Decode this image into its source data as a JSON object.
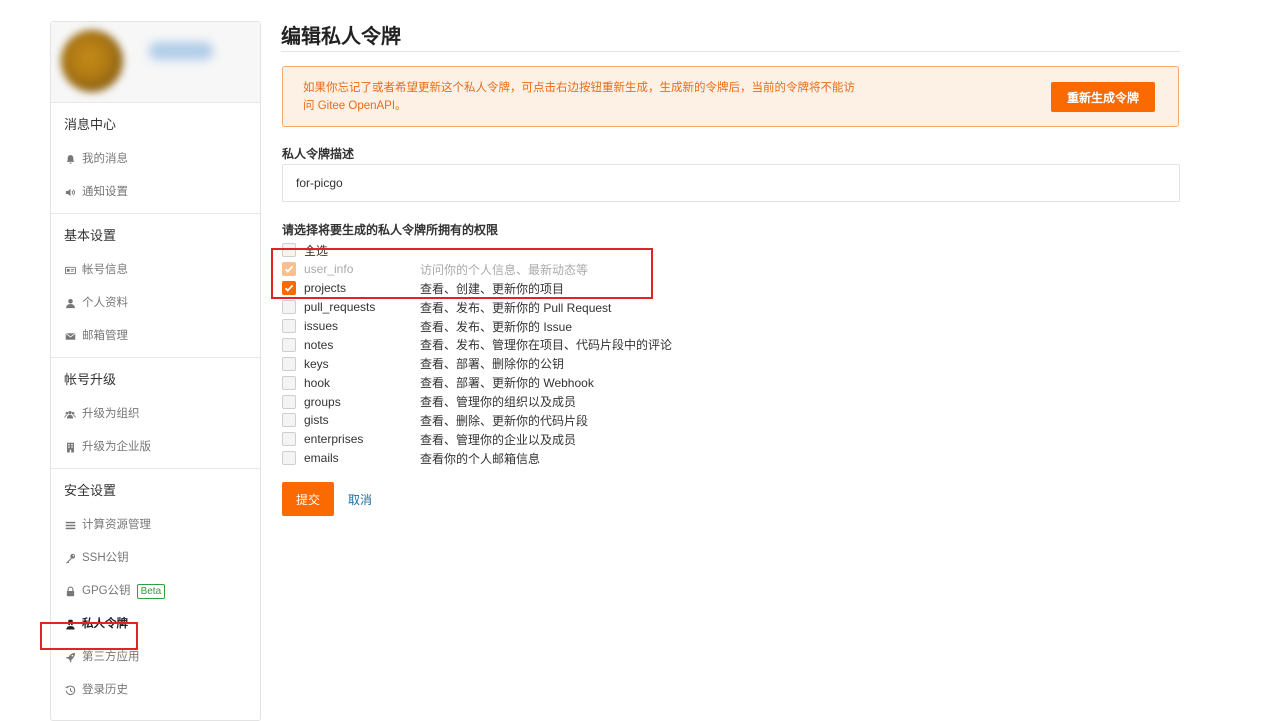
{
  "sidebar": {
    "sections": [
      {
        "title": "消息中心",
        "items": [
          {
            "label": "我的消息",
            "icon": "bell-icon"
          },
          {
            "label": "通知设置",
            "icon": "speaker-icon"
          }
        ]
      },
      {
        "title": "基本设置",
        "items": [
          {
            "label": "帐号信息",
            "icon": "id-card-icon"
          },
          {
            "label": "个人资料",
            "icon": "user-icon"
          },
          {
            "label": "邮箱管理",
            "icon": "envelope-icon"
          }
        ]
      },
      {
        "title": "帐号升级",
        "items": [
          {
            "label": "升级为组织",
            "icon": "users-icon"
          },
          {
            "label": "升级为企业版",
            "icon": "building-icon"
          }
        ]
      },
      {
        "title": "安全设置",
        "items": [
          {
            "label": "计算资源管理",
            "icon": "list-icon"
          },
          {
            "label": "SSH公钥",
            "icon": "key-icon"
          },
          {
            "label": "GPG公钥",
            "icon": "lock-icon",
            "badge": "Beta"
          },
          {
            "label": "私人令牌",
            "icon": "user-secret-icon",
            "active": true
          },
          {
            "label": "第三方应用",
            "icon": "rocket-icon"
          },
          {
            "label": "登录历史",
            "icon": "history-icon"
          }
        ]
      }
    ]
  },
  "main": {
    "title": "编辑私人令牌",
    "notice": {
      "line1": "如果你忘记了或者希望更新这个私人令牌，可点击右边按钮重新生成，生成新的令牌后，当前的令牌将不能访",
      "line2": "问 Gitee OpenAPI。",
      "button_label": "重新生成令牌"
    },
    "description_label": "私人令牌描述",
    "description_value": "for-picgo",
    "permissions_label": "请选择将要生成的私人令牌所拥有的权限",
    "select_all_label": "全选",
    "permissions": [
      {
        "name": "user_info",
        "desc": "访问你的个人信息、最新动态等",
        "checked": true,
        "disabled": true
      },
      {
        "name": "projects",
        "desc": "查看、创建、更新你的项目",
        "checked": true
      },
      {
        "name": "pull_requests",
        "desc": "查看、发布、更新你的 Pull Request",
        "checked": false
      },
      {
        "name": "issues",
        "desc": "查看、发布、更新你的 Issue",
        "checked": false
      },
      {
        "name": "notes",
        "desc": "查看、发布、管理你在项目、代码片段中的评论",
        "checked": false
      },
      {
        "name": "keys",
        "desc": "查看、部署、删除你的公钥",
        "checked": false
      },
      {
        "name": "hook",
        "desc": "查看、部署、更新你的 Webhook",
        "checked": false
      },
      {
        "name": "groups",
        "desc": "查看、管理你的组织以及成员",
        "checked": false
      },
      {
        "name": "gists",
        "desc": "查看、删除、更新你的代码片段",
        "checked": false
      },
      {
        "name": "enterprises",
        "desc": "查看、管理你的企业以及成员",
        "checked": false
      },
      {
        "name": "emails",
        "desc": "查看你的个人邮箱信息",
        "checked": false
      }
    ],
    "submit_label": "提交",
    "cancel_label": "取消"
  },
  "colors": {
    "accent": "#fa6a00",
    "notice_bg": "#fdf1e5",
    "notice_text": "#ea6c17",
    "highlight_box": "#e02424",
    "link": "#1c6ea4",
    "beta": "#2ea043"
  }
}
